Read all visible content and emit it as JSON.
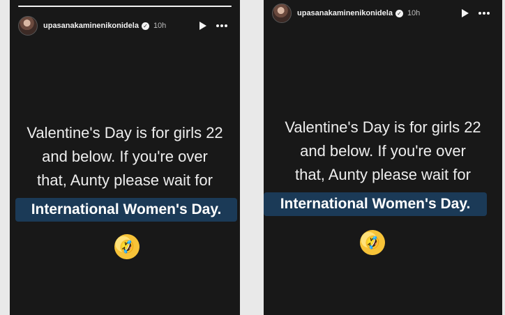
{
  "stories": [
    {
      "username": "upasanakaminenikonidela",
      "time": "10h",
      "verified_glyph": "✓",
      "progress": 1.0,
      "lines": [
        "Valentine's Day is for girls 22",
        "and below. If you're over",
        "that, Aunty please wait for"
      ],
      "highlight": "International Women's Day.",
      "emoji": "🤣"
    },
    {
      "username": "upasanakaminenikonidela",
      "time": "10h",
      "verified_glyph": "✓",
      "lines": [
        "Valentine's Day is for girls 22",
        "and below. If you're over",
        "that, Aunty please wait for"
      ],
      "highlight": "International Women's Day.",
      "emoji": "🤣"
    }
  ],
  "icons": {
    "play": "play-icon",
    "more": "more-options-icon",
    "verified": "verified-badge-icon"
  },
  "colors": {
    "story_background": "#181818",
    "highlight_background": "#1b3a57",
    "text": "#eeeeee"
  }
}
